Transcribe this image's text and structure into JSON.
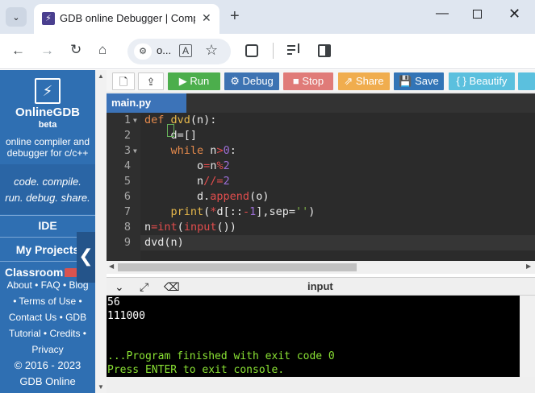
{
  "browser": {
    "tab_title": "GDB online Debugger | Compi",
    "tab_favicon": "⚡",
    "tab_close": "✕",
    "new_tab": "+",
    "url_short": "o...",
    "icons": {
      "back": "←",
      "forward": "→",
      "reload": "↻",
      "home": "⌂",
      "star": "☆",
      "extensions": "extensions-icon",
      "media": "media-icon",
      "sidepanel": "sidepanel-icon"
    },
    "window": {
      "minimize": "—",
      "close": "✕"
    }
  },
  "sidebar": {
    "logo_glyph": "⚡",
    "brand": "OnlineGDB",
    "brand_sub": "beta",
    "desc_line1": "online compiler and",
    "desc_line2": "debugger for c/c++",
    "tagline1": "code. compile.",
    "tagline2": "run. debug. share.",
    "nav": {
      "ide": "IDE",
      "projects": "My Projects",
      "classroom": "Classroom"
    },
    "links": {
      "row1": "About • FAQ • Blog",
      "row2": "• Terms of Use •",
      "row3": "Contact Us • GDB",
      "row4": "Tutorial • Credits •",
      "row5": "Privacy",
      "row6": "© 2016 - 2023",
      "row7": "GDB Online"
    },
    "collapse_glyph": "❮"
  },
  "toolbar": {
    "new_icon": "🗋",
    "upload_icon": "⇪",
    "run": "▶ Run",
    "debug": "⚙ Debug",
    "stop": "■ Stop",
    "share": "⇗ Share",
    "save": "💾 Save",
    "beautify": "{ } Beautify"
  },
  "editor": {
    "file_tab": "main.py",
    "line_numbers": [
      "1",
      "2",
      "3",
      "4",
      "5",
      "6",
      "7",
      "8",
      "9"
    ],
    "lines": {
      "l1": {
        "kw": "def",
        "fn": "dvd",
        "rest": "(n):"
      },
      "l2": {
        "text": "    d=[]"
      },
      "l3": {
        "kw": "while",
        "a": "n",
        "op": ">",
        "num": "0",
        "b": ":"
      },
      "l4": {
        "a": "o",
        "op1": "=",
        "b": "n",
        "op2": "%",
        "num": "2"
      },
      "l5": {
        "a": "n",
        "op": "//=",
        "num": "2"
      },
      "l6": {
        "a": "d.",
        "fn": "append",
        "b": "(o)"
      },
      "l7": {
        "fn": "print",
        "a": "(",
        "op1": "*",
        "b": "d[::",
        "op2": "-",
        "num": "1",
        "c": "],sep=",
        "str": "''",
        "d": ")"
      },
      "l8": {
        "a": "n",
        "op": "=",
        "fn1": "int",
        "b": "(",
        "fn2": "input",
        "c": "())"
      },
      "l9": {
        "text": "dvd(n)"
      }
    }
  },
  "console": {
    "title": "input",
    "lines": [
      "56",
      "111000",
      "",
      "",
      "...Program finished with exit code 0",
      "Press ENTER to exit console."
    ]
  },
  "colors": {
    "sidebar": "#2f6fb2",
    "run": "#4cae4c",
    "debug": "#3d73b2",
    "stop": "#d9534f",
    "share": "#f0ad4e",
    "save": "#3274b6",
    "beautify": "#5bc0de",
    "console_text": "#8ae234"
  }
}
